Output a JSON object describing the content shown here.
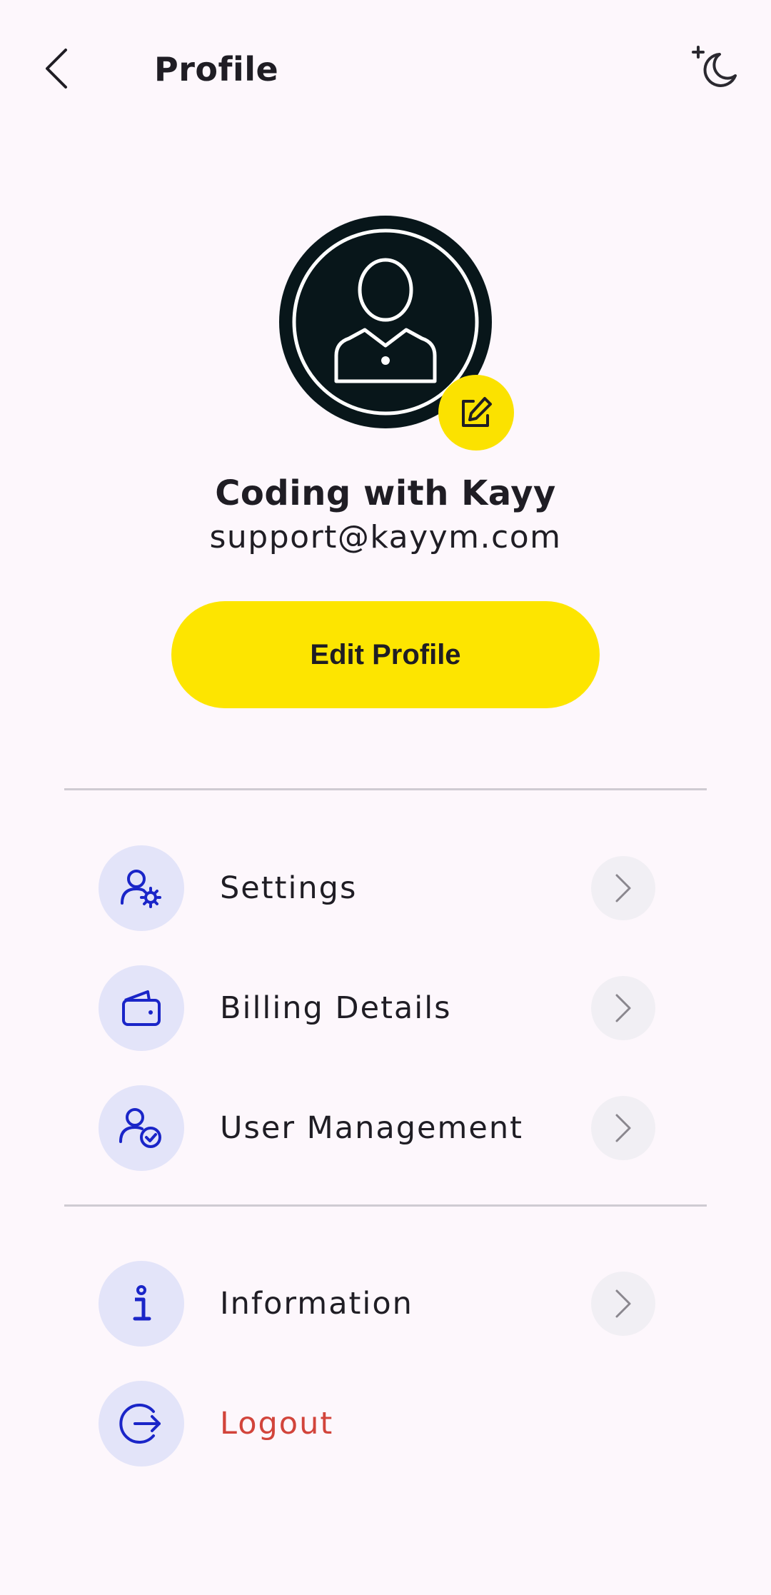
{
  "header": {
    "title": "Profile",
    "back_icon": "chevron-left-icon",
    "theme_icon": "moon-icon"
  },
  "profile": {
    "name": "Coding with Kayy",
    "email": "support@kayym.com",
    "avatar_icon": "user-avatar-icon",
    "edit_avatar_icon": "edit-icon"
  },
  "edit_profile_button": {
    "label": "Edit Profile"
  },
  "menu": {
    "primary": [
      {
        "label": "Settings",
        "icon": "user-settings-icon"
      },
      {
        "label": "Billing Details",
        "icon": "wallet-icon"
      },
      {
        "label": "User Management",
        "icon": "user-check-icon"
      }
    ],
    "secondary": [
      {
        "label": "Information",
        "icon": "info-icon"
      },
      {
        "label": "Logout",
        "icon": "logout-icon"
      }
    ]
  },
  "colors": {
    "background": "#fdf7fc",
    "accent_yellow": "#fde500",
    "icon_blue": "#1a25c8",
    "icon_bg": "#e3e4f9",
    "logout_red": "#d2443b",
    "avatar_dark": "#08161a"
  }
}
